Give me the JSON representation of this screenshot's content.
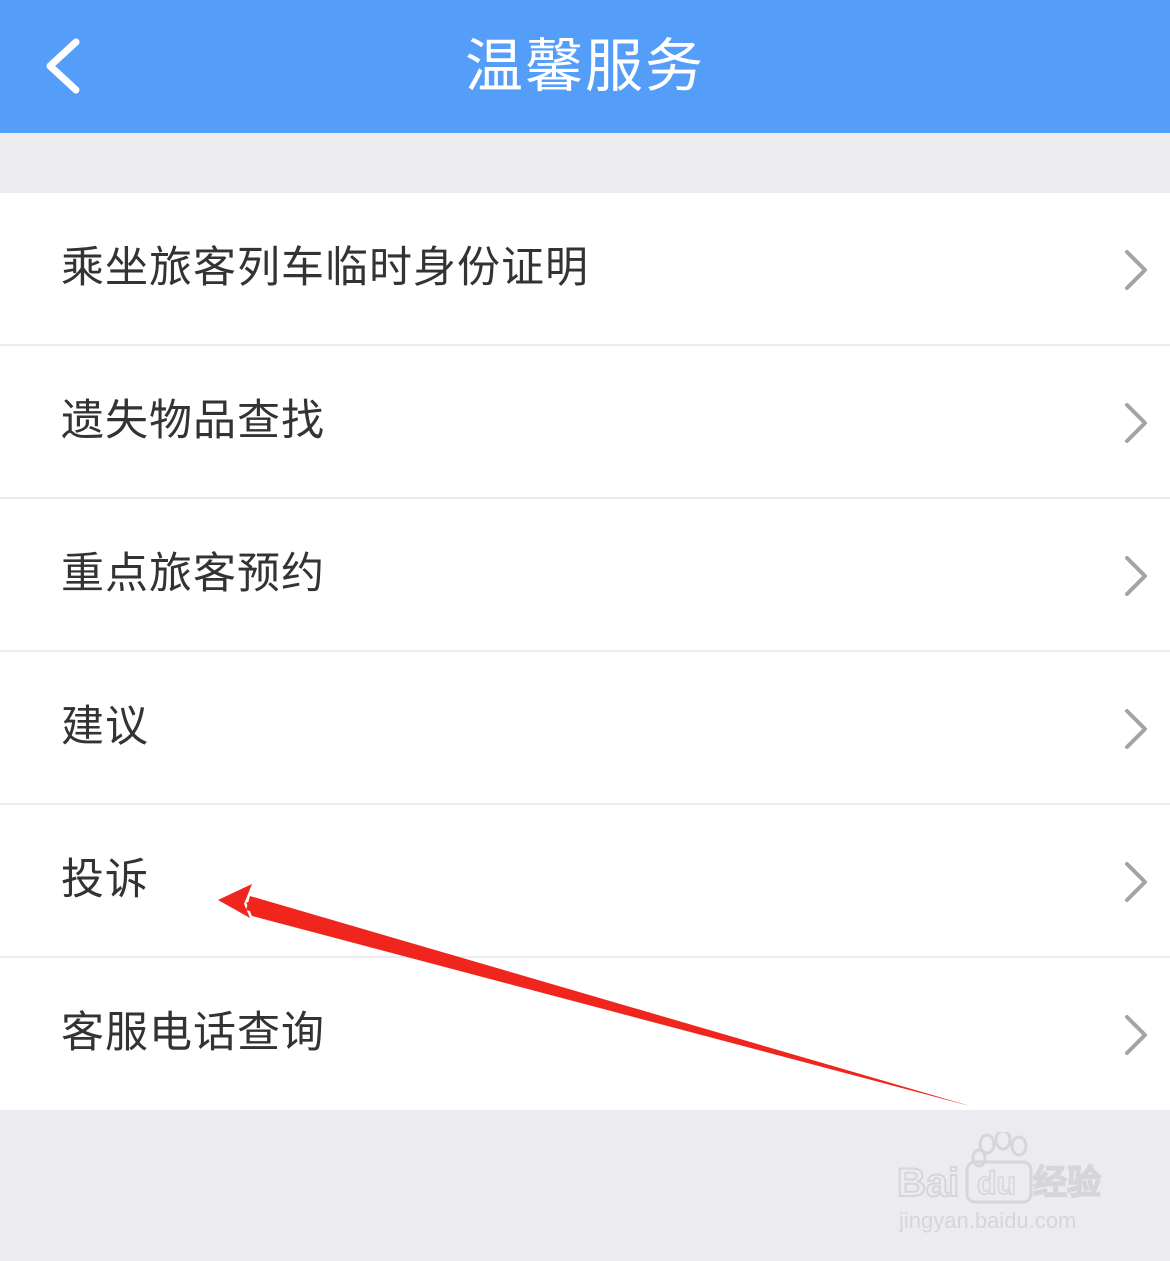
{
  "header": {
    "title": "温馨服务",
    "back_icon": "chevron-left-icon",
    "color": "#549ef9"
  },
  "menu": {
    "items": [
      {
        "label": "乘坐旅客列车临时身份证明",
        "icon": "chevron-right-icon"
      },
      {
        "label": "遗失物品查找",
        "icon": "chevron-right-icon"
      },
      {
        "label": "重点旅客预约",
        "icon": "chevron-right-icon"
      },
      {
        "label": "建议",
        "icon": "chevron-right-icon"
      },
      {
        "label": "投诉",
        "icon": "chevron-right-icon"
      },
      {
        "label": "客服电话查询",
        "icon": "chevron-right-icon"
      }
    ]
  },
  "annotation": {
    "type": "red-arrow",
    "points_to": "投诉",
    "color": "#f0251d"
  },
  "watermark": {
    "brand": "Baidu经验",
    "url": "jingyan.baidu.com"
  }
}
